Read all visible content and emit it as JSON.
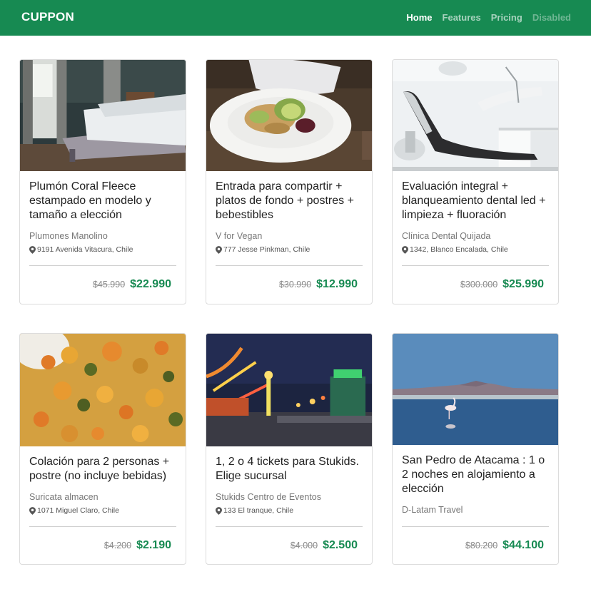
{
  "navbar": {
    "brand": "CUPPON",
    "links": [
      {
        "label": "Home",
        "state": "active"
      },
      {
        "label": "Features",
        "state": "normal"
      },
      {
        "label": "Pricing",
        "state": "normal"
      },
      {
        "label": "Disabled",
        "state": "disabled"
      }
    ]
  },
  "colors": {
    "brand_green": "#178a52",
    "price_green": "#178a52"
  },
  "deals": [
    {
      "title": "Plumón Coral Fleece estampado en modelo y tamaño a elección",
      "merchant": "Plumones Manolino",
      "address": "9191 Avenida Vitacura, Chile",
      "old_price": "$45.990",
      "new_price": "$22.990",
      "image": "bedroom-photo"
    },
    {
      "title": "Entrada para compartir + platos de fondo + postres + bebestibles",
      "merchant": "V for Vegan",
      "address": "777 Jesse Pinkman, Chile",
      "old_price": "$30.990",
      "new_price": "$12.990",
      "image": "salad-plate-photo"
    },
    {
      "title": "Evaluación integral + blanqueamiento dental led + limpieza + fluoración",
      "merchant": "Clínica Dental Quijada",
      "address": "1342, Blanco Encalada, Chile",
      "old_price": "$300.000",
      "new_price": "$25.990",
      "image": "dental-chair-photo"
    },
    {
      "title": "Colación para 2 personas + postre (no incluye bebidas)",
      "merchant": "Suricata almacen",
      "address": "1071 Miguel Claro, Chile",
      "old_price": "$4.200",
      "new_price": "$2.190",
      "image": "vegetable-stew-photo"
    },
    {
      "title": "1, 2 o 4 tickets para Stukids. Elige sucursal",
      "merchant": "Stukids Centro de Eventos",
      "address": "133 El tranque, Chile",
      "old_price": "$4.000",
      "new_price": "$2.500",
      "image": "amusement-park-photo"
    },
    {
      "title": "San Pedro de Atacama : 1 o 2 noches en alojamiento a elección",
      "merchant": "D-Latam Travel",
      "address": "",
      "old_price": "$80.200",
      "new_price": "$44.100",
      "image": "flamingo-lake-photo"
    }
  ]
}
